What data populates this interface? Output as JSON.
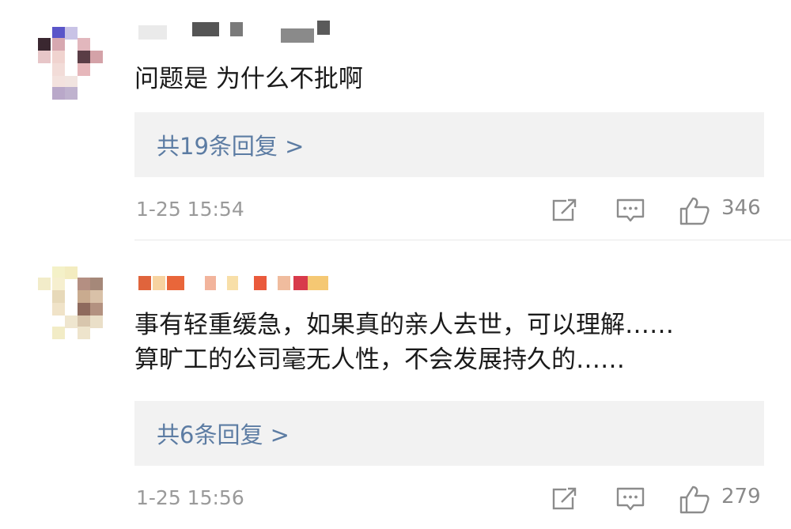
{
  "comments": [
    {
      "text": "问题是 为什么不批啊",
      "reply_link": "共19条回复 >",
      "time": "1-25 15:54",
      "likes": "346"
    },
    {
      "text_lines": [
        "事有轻重缓急，如果真的亲人去世，可以理解……",
        "算旷工的公司毫无人性，不会发展持久的……"
      ],
      "reply_link": "共6条回复 >",
      "time": "1-25 15:56",
      "likes": "279"
    }
  ],
  "colors": {
    "link": "#5c7ca3",
    "meta": "#9a9a9a",
    "reply_bg": "#f2f2f2"
  },
  "icons": [
    "share-icon",
    "comment-icon",
    "like-icon"
  ]
}
